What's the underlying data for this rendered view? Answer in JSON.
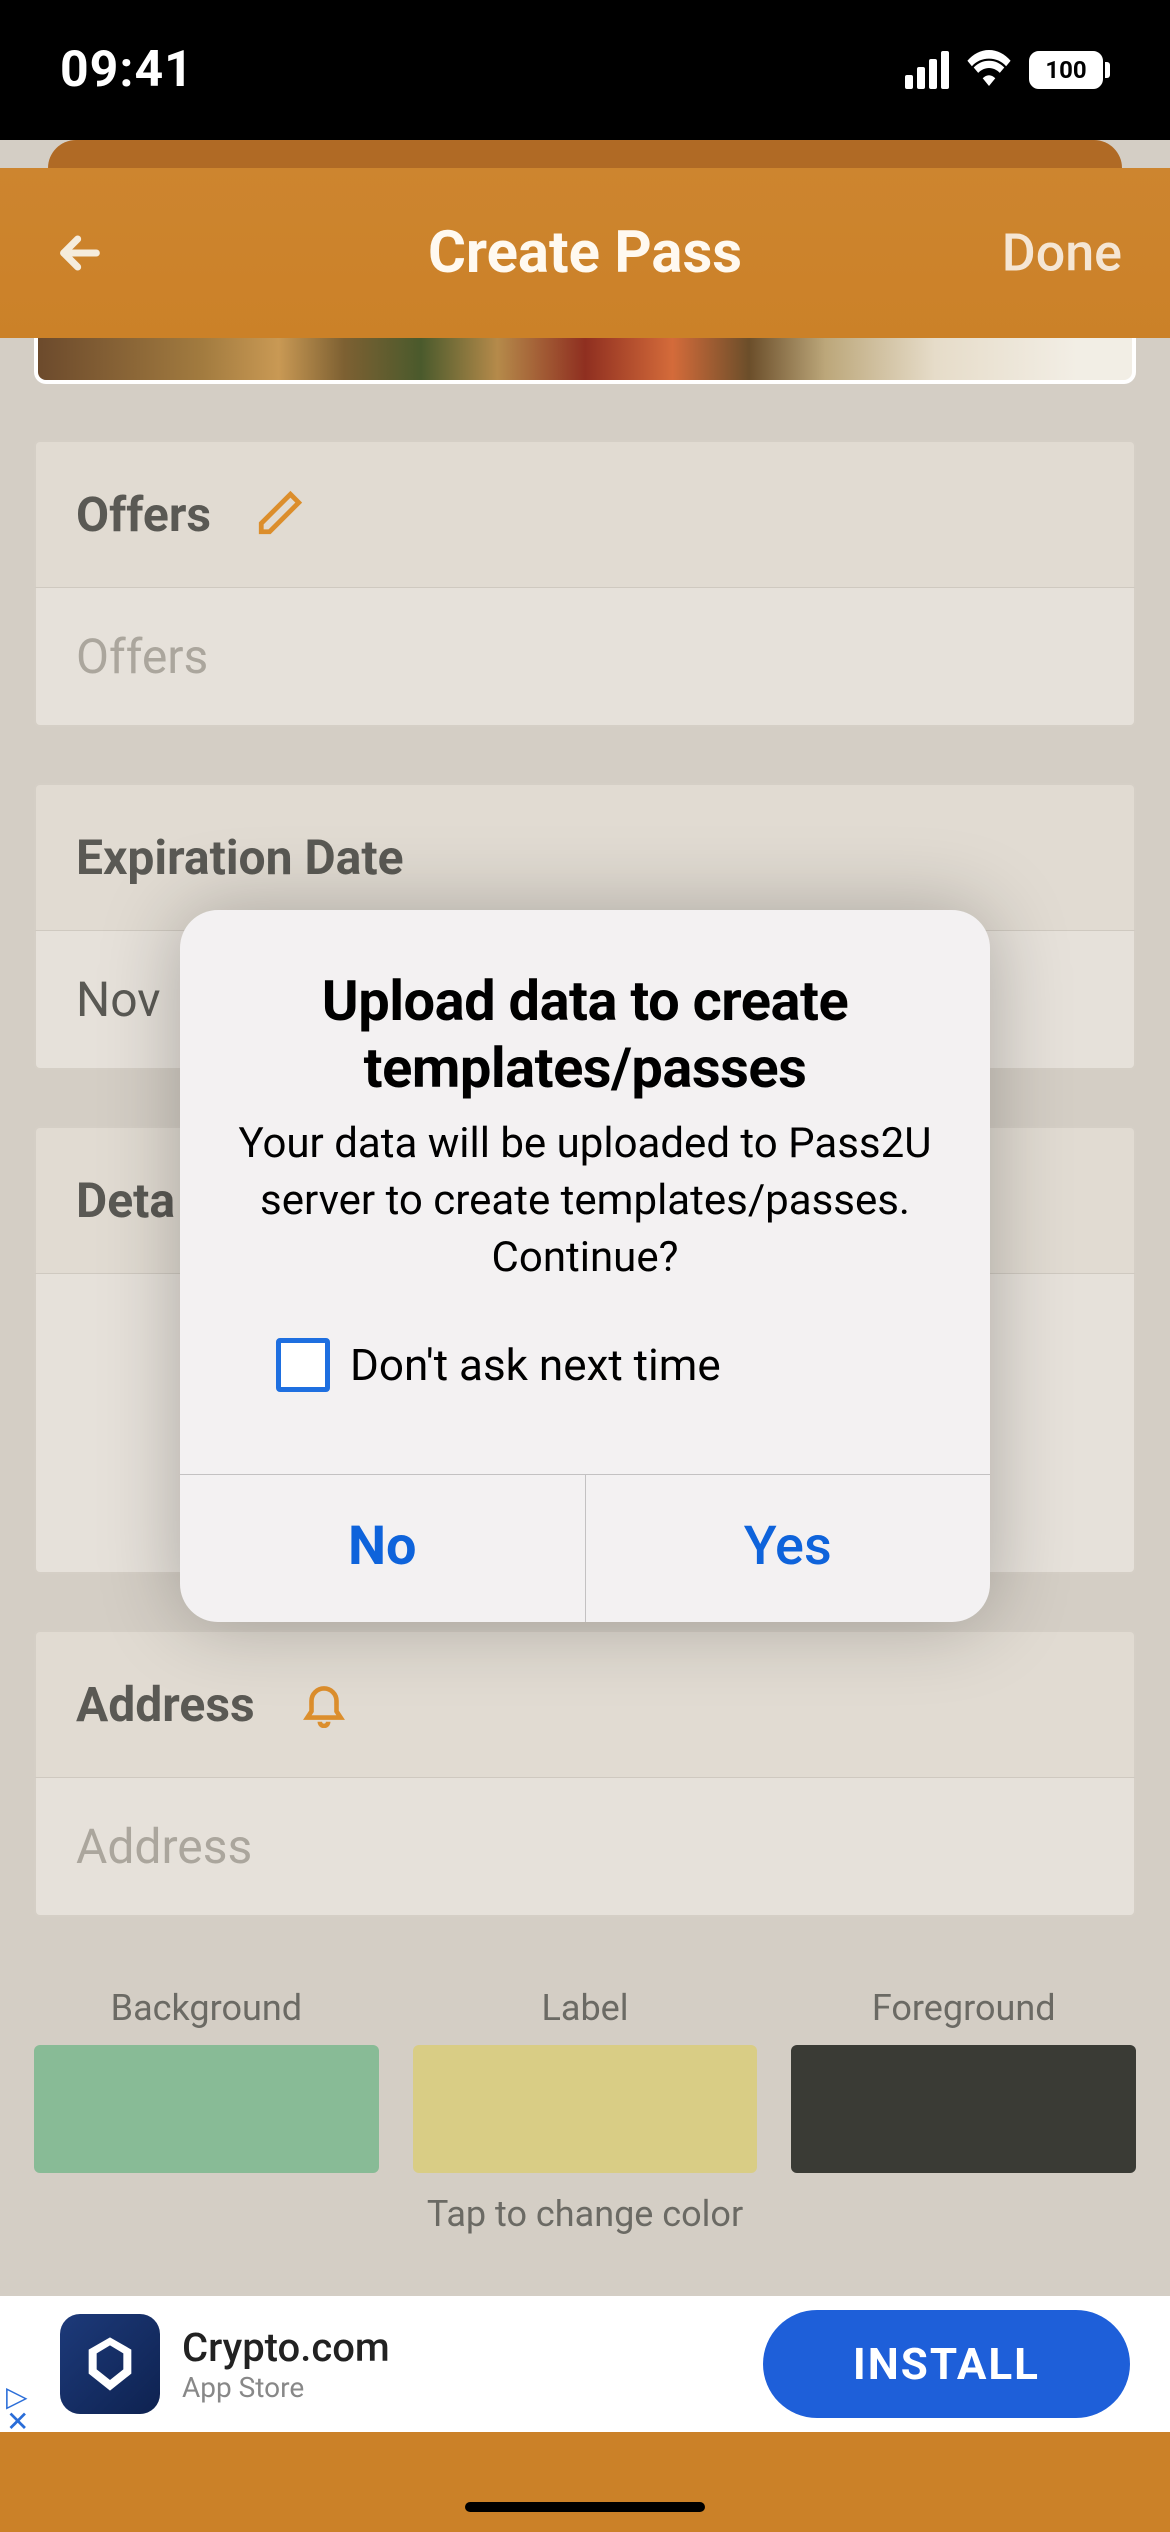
{
  "status": {
    "time": "09:41",
    "battery": "100"
  },
  "nav": {
    "title": "Create Pass",
    "done": "Done"
  },
  "sections": {
    "offers": {
      "label": "Offers",
      "placeholder": "Offers"
    },
    "expiration": {
      "label": "Expiration Date",
      "value": "Nov"
    },
    "details": {
      "label": "Deta"
    },
    "address": {
      "label": "Address",
      "placeholder": "Address"
    }
  },
  "colors": {
    "background_label": "Background",
    "label_label": "Label",
    "foreground_label": "Foreground",
    "hint": "Tap to change color",
    "background_hex": "#88bb96",
    "label_hex": "#d9cd85",
    "foreground_hex": "#3a3b35"
  },
  "ad": {
    "title": "Crypto.com",
    "subtitle": "App Store",
    "cta": "INSTALL"
  },
  "alert": {
    "title": "Upload data to create templates/passes",
    "message": "Your data will be uploaded to Pass2U server to create templates/passes. Continue?",
    "checkbox_label": "Don't ask next time",
    "no": "No",
    "yes": "Yes"
  }
}
